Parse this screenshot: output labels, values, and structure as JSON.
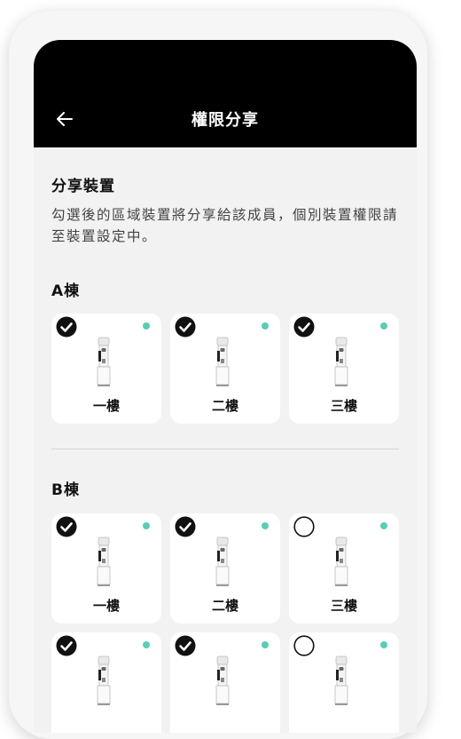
{
  "header": {
    "title": "權限分享",
    "back_icon": "arrow-left-icon"
  },
  "share": {
    "title": "分享裝置",
    "description": "勾選後的區域裝置將分享給該成員，個別裝置權限請至裝置設定中。"
  },
  "groups": [
    {
      "title": "A棟",
      "devices": [
        {
          "label": "一樓",
          "checked": true,
          "online": true
        },
        {
          "label": "二樓",
          "checked": true,
          "online": true
        },
        {
          "label": "三樓",
          "checked": true,
          "online": true
        }
      ]
    },
    {
      "title": "B棟",
      "devices": [
        {
          "label": "一樓",
          "checked": true,
          "online": true
        },
        {
          "label": "二樓",
          "checked": true,
          "online": true
        },
        {
          "label": "三樓",
          "checked": false,
          "online": true
        },
        {
          "label": "",
          "checked": true,
          "online": true
        },
        {
          "label": "",
          "checked": true,
          "online": true
        },
        {
          "label": "",
          "checked": false,
          "online": true
        }
      ]
    }
  ],
  "colors": {
    "header_bg": "#000000",
    "status_dot": "#5ccbb7",
    "card_bg": "#ffffff",
    "screen_bg": "#f2f2f2"
  }
}
